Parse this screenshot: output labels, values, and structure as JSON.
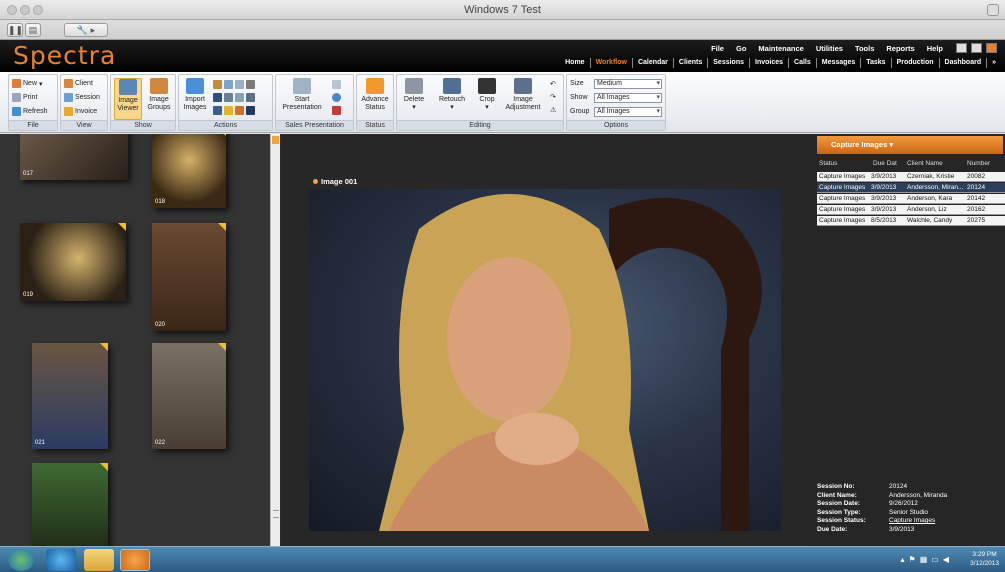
{
  "window": {
    "title": "Windows 7 Test"
  },
  "app": {
    "logo": "Spectra",
    "top_menu": [
      "File",
      "Go",
      "Maintenance",
      "Utilities",
      "Tools",
      "Reports",
      "Help"
    ],
    "nav": [
      "Home",
      "Workflow",
      "Calendar",
      "Clients",
      "Sessions",
      "Invoices",
      "Calls",
      "Messages",
      "Tasks",
      "Production",
      "Dashboard"
    ],
    "nav_active": "Workflow",
    "accent": "#e7832c"
  },
  "ribbon": {
    "file": {
      "label": "File",
      "items": [
        "New",
        "Print",
        "Refresh"
      ]
    },
    "view": {
      "label": "View",
      "items": [
        "Client",
        "Session",
        "Invoice"
      ]
    },
    "show": {
      "label": "Show",
      "image_viewer": "Image Viewer",
      "image_groups": "Image Groups"
    },
    "actions": {
      "label": "Actions",
      "import_images": "Import Images"
    },
    "sales": {
      "label": "Sales Presentation",
      "start": "Start Presentation"
    },
    "status": {
      "label": "Status",
      "advance": "Advance Status"
    },
    "editing": {
      "label": "Editing",
      "delete": "Delete",
      "retouch": "Retouch",
      "crop": "Crop",
      "image_adjustment": "Image Adjustment"
    },
    "options": {
      "label": "Options",
      "size_label": "Size",
      "size_value": "Medium",
      "show_label": "Show",
      "show_value": "All Images",
      "group_label": "Group",
      "group_value": "All Images"
    }
  },
  "thumbnails": [
    "017",
    "018",
    "019",
    "020",
    "021",
    "022"
  ],
  "viewer": {
    "image_label": "Image 001"
  },
  "workflow_panel": {
    "title": "Capture Images",
    "columns": [
      "Status",
      "Due Dat",
      "Client Name",
      "Number"
    ],
    "rows": [
      [
        "Capture Images",
        "3/9/2013",
        "Czerniak, Kristie",
        "20082"
      ],
      [
        "Capture Images",
        "3/9/2013",
        "Andersson, Miran...",
        "20124"
      ],
      [
        "Capture Images",
        "3/9/2013",
        "Anderson, Kara",
        "20142"
      ],
      [
        "Capture Images",
        "3/9/2013",
        "Anderson, Liz",
        "20162"
      ],
      [
        "Capture Images",
        "8/5/2013",
        "Walchle, Candy",
        "20275"
      ]
    ],
    "selected_row": 1
  },
  "session_details": {
    "session_no_label": "Session No:",
    "session_no": "20124",
    "client_name_label": "Client Name:",
    "client_name": "Andersson, Miranda",
    "session_date_label": "Session Date:",
    "session_date": "9/26/2012",
    "session_type_label": "Session Type:",
    "session_type": "Senior Studio",
    "session_status_label": "Session Status:",
    "session_status": "Capture Images",
    "due_date_label": "Due Date:",
    "due_date": "3/9/2013"
  },
  "taskbar": {
    "time": "3:29 PM",
    "date": "3/12/2013"
  }
}
